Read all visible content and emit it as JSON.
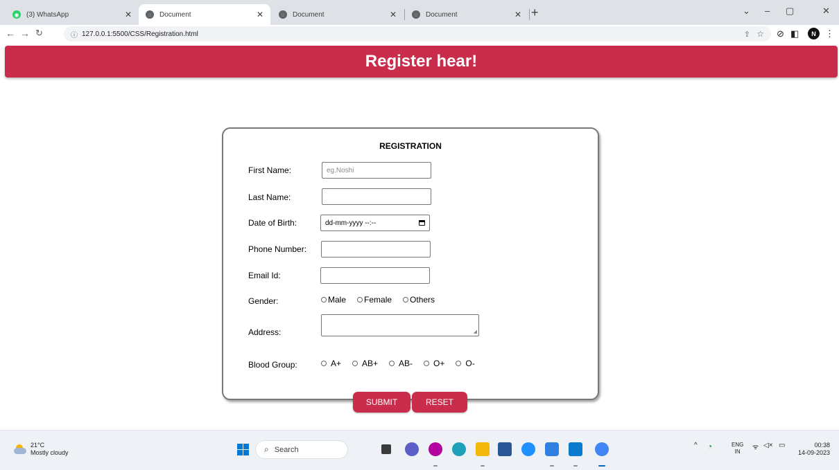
{
  "browser": {
    "tabs": [
      {
        "title": "(3) WhatsApp",
        "favicon": "whatsapp-icon",
        "active": false
      },
      {
        "title": "Document",
        "favicon": "globe-icon",
        "active": true
      },
      {
        "title": "Document",
        "favicon": "globe-icon",
        "active": false
      },
      {
        "title": "Document",
        "favicon": "globe-icon",
        "active": false
      }
    ],
    "tab_close_glyph": "✕",
    "new_tab_glyph": "+",
    "url": "127.0.0.1:5500/CSS/Registration.html",
    "profile_initial": "N"
  },
  "page": {
    "header_title": "Register hear!",
    "form_title": "REGISTRATION",
    "fields": {
      "first_name": {
        "label": "First Name:",
        "placeholder": "eg.Noshi"
      },
      "last_name": {
        "label": "Last Name:"
      },
      "dob": {
        "label": "Date of Birth:",
        "value": "dd-mm-yyyy --:--"
      },
      "phone": {
        "label": "Phone Number:"
      },
      "email": {
        "label": "Email Id:"
      },
      "address": {
        "label": "Address:"
      }
    },
    "gender": {
      "label": "Gender:",
      "options": [
        "Male",
        "Female",
        "Others"
      ]
    },
    "blood_group": {
      "label": "Blood Group:",
      "options": [
        "A+",
        "AB+",
        "AB-",
        "O+",
        "O-"
      ]
    },
    "buttons": {
      "submit": "SUBMIT",
      "reset": "RESET"
    }
  },
  "taskbar": {
    "weather_temp": "21°C",
    "weather_desc": "Mostly cloudy",
    "search_label": "Search",
    "lang_top": "ENG",
    "lang_bottom": "IN",
    "time": "00:38",
    "date": "14-09-2023"
  },
  "colors": {
    "accent": "#c92d4b",
    "tabstrip": "#dee1e6",
    "taskbar": "#eef2f6"
  }
}
